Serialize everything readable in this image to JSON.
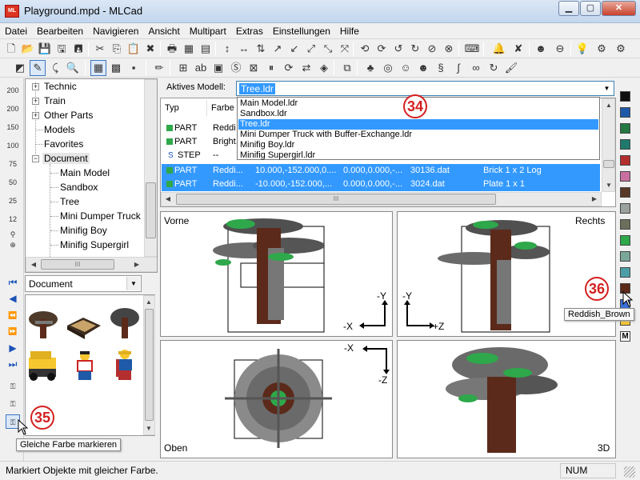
{
  "window": {
    "title": "Playground.mpd - MLCad",
    "app_icon_text": "ML"
  },
  "menu": [
    "Datei",
    "Bearbeiten",
    "Navigieren",
    "Ansicht",
    "Multipart",
    "Extras",
    "Einstellungen",
    "Hilfe"
  ],
  "tree": {
    "items": [
      {
        "label": "Technic",
        "expander": "+"
      },
      {
        "label": "Train",
        "expander": "+"
      },
      {
        "label": "Other Parts",
        "expander": "+"
      },
      {
        "label": "Models",
        "expander": ""
      },
      {
        "label": "Favorites",
        "expander": ""
      },
      {
        "label": "Document",
        "expander": "−"
      },
      {
        "label": "Main Model",
        "expander": ""
      },
      {
        "label": "Sandbox",
        "expander": ""
      },
      {
        "label": "Tree",
        "expander": ""
      },
      {
        "label": "Mini Dumper Truck",
        "expander": ""
      },
      {
        "label": "Minifig Boy",
        "expander": ""
      },
      {
        "label": "Minifig Supergirl",
        "expander": ""
      }
    ]
  },
  "library": {
    "combo_value": "Document"
  },
  "zoom_buttons": [
    "200",
    "200",
    "150",
    "100",
    "75",
    "50",
    "25",
    "12"
  ],
  "model": {
    "label": "Aktives Modell:",
    "selected": "Tree.ldr",
    "dropdown": [
      "Main Model.ldr",
      "Sandbox.ldr",
      "Tree.ldr",
      "Mini Dumper Truck with Buffer-Exchange.ldr",
      "Minifig Boy.ldr",
      "Minifig Supergirl.ldr"
    ]
  },
  "parts_list": {
    "headers": [
      "Typ",
      "Farbe"
    ],
    "rows": [
      {
        "type": "PART",
        "color": "Reddi",
        "pos": "",
        "rot": "",
        "file": "",
        "desc": "",
        "selected": false,
        "icon": "part"
      },
      {
        "type": "PART",
        "color": "Bright.",
        "pos": "",
        "rot": "",
        "file": "",
        "desc": "",
        "selected": false,
        "icon": "part"
      },
      {
        "type": "STEP",
        "color": "--",
        "pos": "",
        "rot": "",
        "file": "",
        "desc": "",
        "selected": false,
        "icon": "step"
      },
      {
        "type": "PART",
        "color": "Reddi...",
        "pos": "10.000,-152.000,0....",
        "rot": "0.000,0.000,-...",
        "file": "30136.dat",
        "desc": "Brick  1 x  2 Log",
        "selected": true,
        "icon": "part"
      },
      {
        "type": "PART",
        "color": "Reddi...",
        "pos": "-10.000,-152.000,...",
        "rot": "0.000,0.000,-...",
        "file": "3024.dat",
        "desc": "Plate  1 x  1",
        "selected": true,
        "icon": "part"
      }
    ]
  },
  "viewports": {
    "front": {
      "label": "Vorne",
      "axes": [
        "-Y",
        "-X"
      ]
    },
    "right": {
      "label": "Rechts",
      "axes": [
        "-Y",
        "+Z"
      ]
    },
    "top": {
      "label": "Oben",
      "axes": [
        "-X",
        "-Z"
      ]
    },
    "threed": {
      "label": "3D"
    }
  },
  "colors": [
    "#101010",
    "#1e5aa8",
    "#237841",
    "#1f7a6d",
    "#b52e2e",
    "#c870a0",
    "#583927",
    "#9ba19d",
    "#6d6e5c",
    "#2ea84a",
    "#7ba79a",
    "#4c9ea6",
    "#5b2a1a",
    "#3a6fd8",
    "#f6c72f",
    "#ffffff"
  ],
  "color_bar_last": "M",
  "callouts": {
    "c34": "34",
    "c35": "35",
    "c36": "36"
  },
  "tooltips": {
    "color": "Reddish_Brown",
    "mark": "Gleiche Farbe markieren"
  },
  "status": {
    "text": "Markiert Objekte mit gleicher Farbe.",
    "num": "NUM"
  }
}
